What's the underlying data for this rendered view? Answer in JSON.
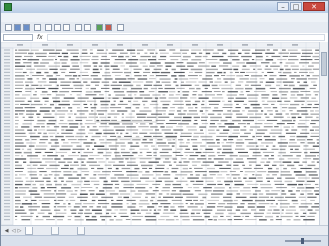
{
  "window": {
    "title": "",
    "colors": {
      "titlebar": "#c7d7ee",
      "accent": "#2f8a3b"
    }
  },
  "menu": {
    "items": [
      "",
      "",
      "",
      "",
      "",
      "",
      "",
      ""
    ]
  },
  "toolbar": {
    "icon_names": [
      "new-icon",
      "open-icon",
      "save-icon",
      "print-icon",
      "cut-icon",
      "copy-icon",
      "paste-icon",
      "undo-icon",
      "redo-icon",
      "sort-icon",
      "chart-icon",
      "zoom-icon"
    ]
  },
  "formula_bar": {
    "name_box": "",
    "fx": "fx",
    "formula": ""
  },
  "sheet": {
    "tabs": [
      "",
      "",
      ""
    ]
  },
  "statusbar": {
    "status": "",
    "zoom": ""
  }
}
